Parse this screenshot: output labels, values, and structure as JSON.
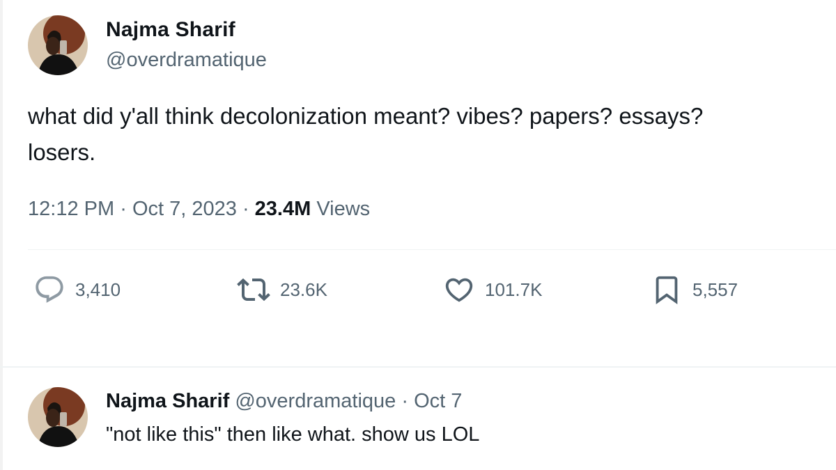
{
  "tweet": {
    "author": {
      "name": "Najma Sharif",
      "handle": "@overdramatique",
      "avatar_icon": "profile-photo"
    },
    "text_lines": [
      "what did y'all think decolonization meant? vibes? papers? essays?",
      "losers."
    ],
    "time": "12:12 PM",
    "date": "Oct 7, 2023",
    "separator": "·",
    "views_count": "23.4M",
    "views_label": "Views",
    "stats": {
      "replies": "3,410",
      "reposts": "23.6K",
      "likes": "101.7K",
      "bookmarks": "5,557"
    },
    "icons": {
      "reply": "reply-icon",
      "repost": "repost-icon",
      "like": "heart-icon",
      "bookmark": "bookmark-icon"
    }
  },
  "reply": {
    "author": {
      "name": "Najma Sharif",
      "handle": "@overdramatique"
    },
    "separator": "·",
    "date": "Oct 7",
    "text": "\"not like this\" then like what. show us LOL"
  },
  "colors": {
    "text_primary": "#0f1419",
    "text_secondary": "#536471",
    "divider": "#eff3f4",
    "background": "#ffffff"
  }
}
